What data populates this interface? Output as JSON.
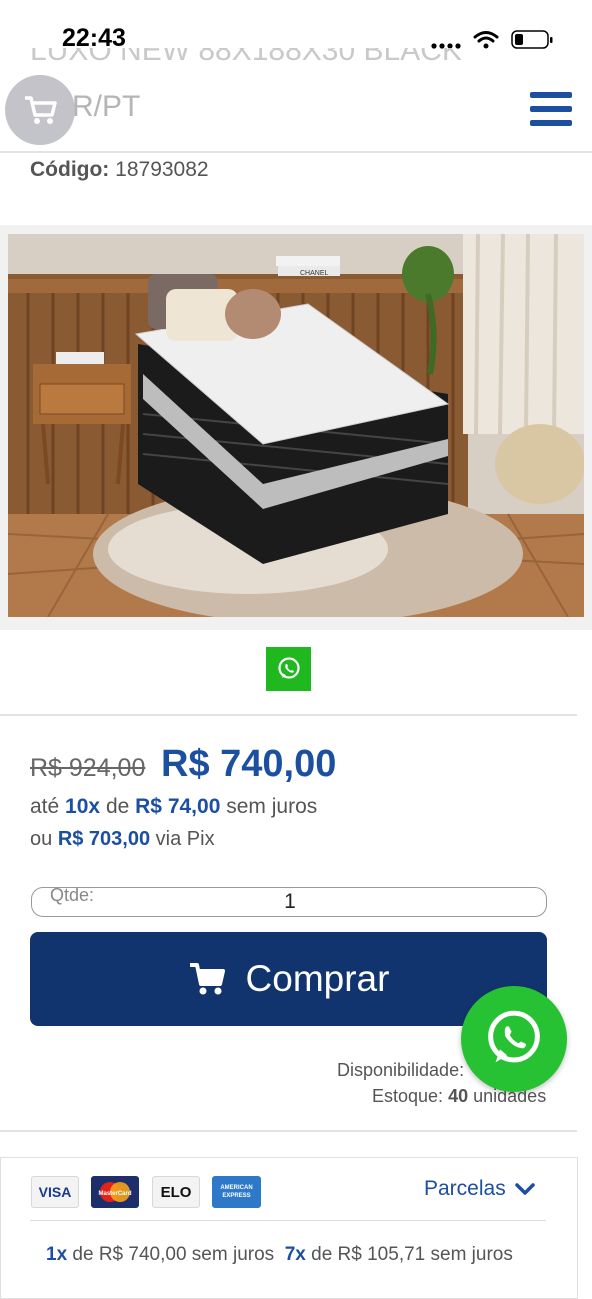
{
  "status": {
    "time": "22:43"
  },
  "header": {
    "title_partial": "LUXO NEW 88X188X30 BLACK",
    "title_line2": "R/PT",
    "code_label": "Código:",
    "code_value": "18793082"
  },
  "image": {
    "pillow_text": "CHANEL"
  },
  "price": {
    "old": "R$ 924,00",
    "new": "R$ 740,00",
    "installment_prefix": "até",
    "installment_count": "10x",
    "installment_mid": "de",
    "installment_value": "R$ 74,00",
    "installment_suffix": "sem juros",
    "pix_prefix": "ou",
    "pix_value": "R$ 703,00",
    "pix_suffix": "via Pix"
  },
  "quantity": {
    "label": "Qtde:",
    "value": "1"
  },
  "buy": {
    "label": "Comprar"
  },
  "availability": {
    "label": "Disponibilidade:",
    "stock_label": "Estoque:",
    "stock_value": "40",
    "stock_unit": "unidades"
  },
  "payment": {
    "cards": [
      "VISA",
      "MasterCard",
      "ELO",
      "AMERICAN EXPRESS"
    ],
    "parcelas_label": "Parcelas",
    "row": [
      {
        "count": "1x",
        "text": "de R$ 740,00 sem juros"
      },
      {
        "count": "7x",
        "text": "de R$ 105,71 sem juros"
      }
    ]
  },
  "colors": {
    "brand_blue": "#1c4fa0",
    "button_navy": "#12346e",
    "whatsapp_green": "#27c234"
  }
}
